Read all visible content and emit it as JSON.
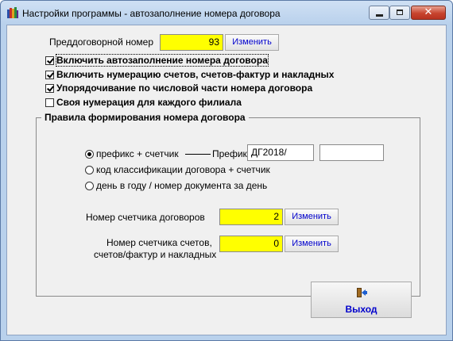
{
  "window": {
    "title": "Настройки программы - автозаполнение номера договора",
    "minimize_glyph": "",
    "maximize_glyph": "",
    "close_glyph": "✕"
  },
  "pre_contract": {
    "label": "Преддоговорной номер",
    "value": "93",
    "button": "Изменить"
  },
  "options": [
    {
      "label": "Включить автозаполнение номера договора",
      "checked": true
    },
    {
      "label": "Включить нумерацию счетов, счетов-фактур и накладных",
      "checked": true
    },
    {
      "label": "Упорядочивание по числовой части номера договора",
      "checked": true
    },
    {
      "label": "Своя нумерация для каждого филиала",
      "checked": false
    }
  ],
  "rules": {
    "title": "Правила формирования номера договора",
    "radios": [
      {
        "label": "префикс + счетчик",
        "selected": true
      },
      {
        "label": "код классификации  договора + счетчик",
        "selected": false
      },
      {
        "label": "день в году / номер документа за день",
        "selected": false
      }
    ],
    "prefix_label": "Префикс",
    "prefix_value": "ДГ2018/",
    "extra_value": "",
    "contract_counter": {
      "label": "Номер  счетчика договоров",
      "value": "2",
      "button": "Изменить"
    },
    "invoice_counter": {
      "label_line1": "Номер  счетчика счетов,",
      "label_line2": "счетов/фактур и накладных",
      "value": "0",
      "button": "Изменить"
    }
  },
  "exit_button": {
    "label": "Выход",
    "icon": "exit-door-icon"
  },
  "colors": {
    "highlight_field": "#ffff00",
    "button_text": "#0000cc",
    "close_button": "#c7442e"
  }
}
